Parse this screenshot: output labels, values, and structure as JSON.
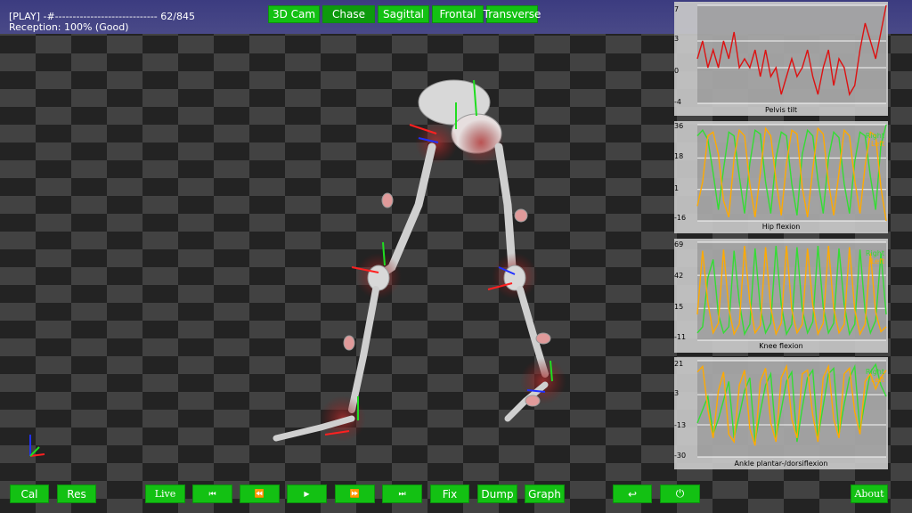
{
  "status": {
    "play_line": "[PLAY] -#----------------------------- 62/845",
    "reception_line": "Reception: 100% (Good)"
  },
  "view_buttons": [
    {
      "label": "3D Cam",
      "active": false
    },
    {
      "label": "Chase",
      "active": true
    },
    {
      "label": "Sagittal",
      "active": false
    },
    {
      "label": "Frontal",
      "active": false
    },
    {
      "label": "Transverse",
      "active": false
    }
  ],
  "bottom_left_buttons": [
    {
      "label": "Cal"
    },
    {
      "label": "Res"
    }
  ],
  "playback_buttons": [
    {
      "label": "Live",
      "icon": "text"
    },
    {
      "label": "",
      "icon": "skip-back-icon",
      "glyph": "⏮"
    },
    {
      "label": "",
      "icon": "rewind-icon",
      "glyph": "⏪"
    },
    {
      "label": "",
      "icon": "play-icon",
      "glyph": "▶"
    },
    {
      "label": "",
      "icon": "fast-forward-icon",
      "glyph": "⏩"
    },
    {
      "label": "",
      "icon": "skip-forward-icon",
      "glyph": "⏭"
    }
  ],
  "action_buttons": [
    {
      "label": "Fix"
    },
    {
      "label": "Dump"
    },
    {
      "label": "Graph"
    }
  ],
  "right_buttons": [
    {
      "icon": "undo-icon",
      "glyph": "↩"
    },
    {
      "icon": "power-icon",
      "glyph": "⏻"
    }
  ],
  "about_button": "About",
  "colors": {
    "sky": "#3a3a7a",
    "button_green": "#13c113",
    "right_series": "#33dd33",
    "left_series": "#ffaa00",
    "pelvis_series": "#dd1111"
  },
  "chart_data": [
    {
      "type": "line",
      "title": "Pelvis tilt",
      "ylim": [
        -4,
        7
      ],
      "yticks": [
        7,
        3,
        0,
        -4
      ],
      "series": [
        {
          "name": "",
          "color": "#dd1111",
          "values": [
            1,
            3,
            0,
            2,
            0,
            3,
            1,
            4,
            0,
            1,
            0,
            2,
            -1,
            2,
            -1,
            0,
            -3,
            -1,
            1,
            -1,
            0,
            2,
            -1,
            -3,
            0,
            2,
            -2,
            1,
            0,
            -3,
            -2,
            2,
            5,
            3,
            1,
            4,
            7
          ]
        }
      ]
    },
    {
      "type": "line",
      "title": "Hip flexion",
      "ylim": [
        -16,
        36
      ],
      "yticks": [
        36,
        18,
        1,
        -16
      ],
      "legend": [
        "Right",
        "Left"
      ],
      "series": [
        {
          "name": "Right",
          "color": "#33dd33",
          "values": [
            30,
            33,
            28,
            10,
            -10,
            12,
            32,
            30,
            8,
            -12,
            15,
            33,
            31,
            5,
            -12,
            18,
            32,
            30,
            4,
            -13,
            20,
            33,
            30,
            6,
            -12,
            18,
            32,
            29,
            4,
            -12,
            16,
            32,
            30,
            8,
            -10,
            25,
            36
          ]
        },
        {
          "name": "Left",
          "color": "#ffaa00",
          "values": [
            -8,
            5,
            30,
            32,
            20,
            -5,
            -14,
            18,
            33,
            30,
            4,
            -14,
            10,
            34,
            30,
            6,
            -13,
            15,
            33,
            31,
            2,
            -14,
            12,
            34,
            31,
            5,
            -13,
            10,
            33,
            30,
            6,
            -12,
            14,
            32,
            30,
            2,
            -16
          ]
        }
      ]
    },
    {
      "type": "line",
      "title": "Knee flexion",
      "ylim": [
        -11,
        69
      ],
      "yticks": [
        69,
        42,
        15,
        -11
      ],
      "legend": [
        "Right",
        "Left"
      ],
      "series": [
        {
          "name": "Right",
          "color": "#33dd33",
          "values": [
            -5,
            0,
            40,
            55,
            10,
            -5,
            0,
            62,
            20,
            -6,
            2,
            64,
            15,
            -5,
            3,
            66,
            18,
            -6,
            2,
            65,
            14,
            -5,
            4,
            66,
            16,
            -5,
            3,
            64,
            18,
            -6,
            2,
            63,
            12,
            -5,
            5,
            60,
            10
          ]
        },
        {
          "name": "Left",
          "color": "#ffaa00",
          "values": [
            10,
            62,
            20,
            -5,
            3,
            63,
            15,
            -6,
            2,
            66,
            20,
            -5,
            1,
            65,
            16,
            -6,
            3,
            66,
            14,
            -5,
            2,
            64,
            18,
            -6,
            3,
            66,
            15,
            -5,
            2,
            65,
            14,
            -6,
            2,
            60,
            12,
            -4,
            0
          ]
        }
      ]
    },
    {
      "type": "line",
      "title": "Ankle plantar-/dorsiflexion",
      "ylim": [
        -30,
        21
      ],
      "yticks": [
        21,
        3,
        -13,
        -30
      ],
      "legend": [
        "Right",
        "Left"
      ],
      "series": [
        {
          "name": "Right",
          "color": "#33dd33",
          "values": [
            -12,
            -5,
            2,
            -18,
            -10,
            0,
            10,
            -20,
            -8,
            5,
            12,
            -22,
            -6,
            8,
            14,
            -20,
            -5,
            10,
            15,
            -22,
            -4,
            12,
            16,
            -20,
            -3,
            14,
            17,
            -18,
            -2,
            12,
            18,
            -16,
            0,
            15,
            19,
            8,
            2
          ]
        },
        {
          "name": "Left",
          "color": "#ffaa00",
          "values": [
            15,
            18,
            -5,
            -20,
            5,
            15,
            -18,
            -22,
            8,
            16,
            -15,
            -24,
            10,
            17,
            -12,
            -22,
            12,
            18,
            -10,
            -20,
            14,
            16,
            -8,
            -22,
            12,
            18,
            -10,
            -20,
            14,
            17,
            -6,
            -18,
            10,
            14,
            6,
            12,
            16
          ]
        }
      ]
    }
  ]
}
